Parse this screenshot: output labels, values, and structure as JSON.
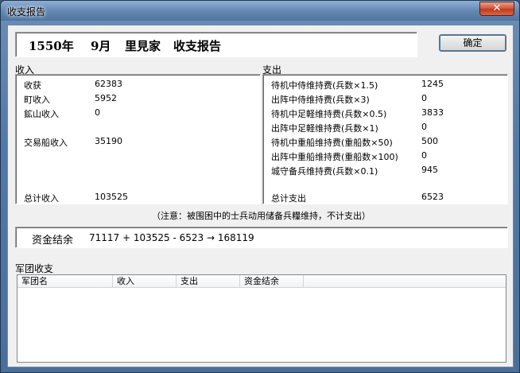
{
  "window": {
    "title": "收支报告",
    "close_glyph": "✕"
  },
  "header": {
    "year": "1550年",
    "month": "9月",
    "clan": "里見家",
    "report": "收支报告"
  },
  "ok_button": "确定",
  "income": {
    "label": "收入",
    "items": [
      {
        "label": "收获",
        "value": "62383"
      },
      {
        "label": "町收入",
        "value": "5952"
      },
      {
        "label": "鉱山收入",
        "value": "0"
      },
      {
        "label": "交易船收入",
        "value": "35190"
      }
    ],
    "total_label": "总计收入",
    "total_value": "103525"
  },
  "expense": {
    "label": "支出",
    "items": [
      {
        "label": "待机中侍维持费(兵数×1.5)",
        "value": "1245"
      },
      {
        "label": "出阵中侍维持费(兵数×3)",
        "value": "0"
      },
      {
        "label": "待机中足軽维持费(兵数×0.5)",
        "value": "3833"
      },
      {
        "label": "出阵中足軽维持费(兵数×1)",
        "value": "0"
      },
      {
        "label": "待机中重船维持费(重船数×50)",
        "value": "500"
      },
      {
        "label": "出阵中重船维持费(重船数×100)",
        "value": "0"
      },
      {
        "label": "城守备兵维持费(兵数×0.1)",
        "value": "945"
      }
    ],
    "total_label": "总计支出",
    "total_value": "6523"
  },
  "note": "（注意：被围困中的士兵动用储备兵糧维持，不计支出）",
  "balance": {
    "label": "资金结余",
    "formula": "71117 + 103525 - 6523 → 168119"
  },
  "legion": {
    "label": "军团收支",
    "columns": [
      "军团名",
      "收入",
      "支出",
      "资金结余"
    ]
  }
}
